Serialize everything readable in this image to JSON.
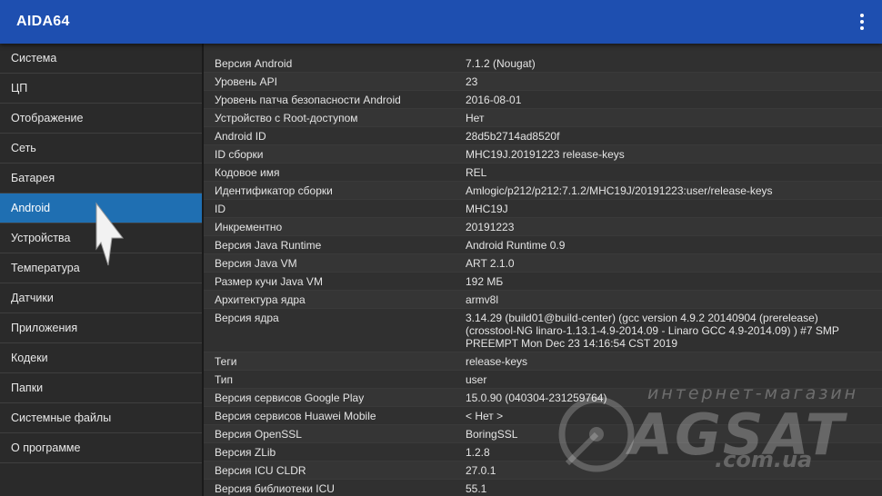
{
  "app": {
    "title": "AIDA64"
  },
  "sidebar": {
    "items": [
      {
        "label": "Система"
      },
      {
        "label": "ЦП"
      },
      {
        "label": "Отображение"
      },
      {
        "label": "Сеть"
      },
      {
        "label": "Батарея"
      },
      {
        "label": "Android",
        "active": true
      },
      {
        "label": "Устройства"
      },
      {
        "label": "Температура"
      },
      {
        "label": "Датчики"
      },
      {
        "label": "Приложения"
      },
      {
        "label": "Кодеки"
      },
      {
        "label": "Папки"
      },
      {
        "label": "Системные файлы"
      },
      {
        "label": "О программе"
      }
    ]
  },
  "details": [
    {
      "key": "Версия Android",
      "value": "7.1.2 (Nougat)"
    },
    {
      "key": "Уровень API",
      "value": "23"
    },
    {
      "key": "Уровень патча безопасности Android",
      "value": "2016-08-01"
    },
    {
      "key": "Устройство с Root-доступом",
      "value": "Нет"
    },
    {
      "key": "Android ID",
      "value": "28d5b2714ad8520f"
    },
    {
      "key": "ID сборки",
      "value": "MHC19J.20191223 release-keys"
    },
    {
      "key": "Кодовое имя",
      "value": "REL"
    },
    {
      "key": "Идентификатор сборки",
      "value": "Amlogic/p212/p212:7.1.2/MHC19J/20191223:user/release-keys"
    },
    {
      "key": "ID",
      "value": "MHC19J"
    },
    {
      "key": "Инкрементно",
      "value": "20191223"
    },
    {
      "key": "Версия Java Runtime",
      "value": "Android Runtime 0.9"
    },
    {
      "key": "Версия Java VM",
      "value": "ART 2.1.0"
    },
    {
      "key": "Размер кучи Java VM",
      "value": "192 МБ"
    },
    {
      "key": "Архитектура ядра",
      "value": "armv8l"
    },
    {
      "key": "Версия ядра",
      "value": "3.14.29 (build01@build-center) (gcc version 4.9.2 20140904 (prerelease) (crosstool-NG linaro-1.13.1-4.9-2014.09 - Linaro GCC 4.9-2014.09) ) #7 SMP PREEMPT Mon Dec 23 14:16:54 CST 2019"
    },
    {
      "key": "Теги",
      "value": "release-keys"
    },
    {
      "key": "Тип",
      "value": "user"
    },
    {
      "key": "Версия сервисов Google Play",
      "value": "15.0.90 (040304-231259764)"
    },
    {
      "key": "Версия сервисов Huawei Mobile",
      "value": "< Нет >"
    },
    {
      "key": "Версия OpenSSL",
      "value": "BoringSSL"
    },
    {
      "key": "Версия ZLib",
      "value": "1.2.8"
    },
    {
      "key": "Версия ICU CLDR",
      "value": "27.0.1"
    },
    {
      "key": "Версия библиотеки ICU",
      "value": "55.1"
    }
  ],
  "watermark": {
    "subtitle": "интернет-магазин",
    "brand": "AGSAT",
    "domain": ".com.ua"
  },
  "colors": {
    "appbar": "#1e4fb0",
    "active_item": "#1f6fb2",
    "background": "#2b2b2b"
  },
  "icons": {
    "menu": "overflow-menu-icon",
    "pointer": "mouse-pointer-icon"
  }
}
